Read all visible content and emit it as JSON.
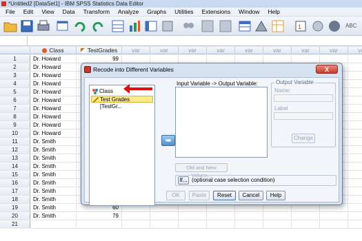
{
  "window": {
    "title": "*Untitled2 [DataSet1] - IBM SPSS Statistics Data Editor"
  },
  "menu": [
    "File",
    "Edit",
    "View",
    "Data",
    "Transform",
    "Analyze",
    "Graphs",
    "Utilities",
    "Extensions",
    "Window",
    "Help"
  ],
  "toolbar": {
    "icons": [
      "open-folder-icon",
      "save-icon",
      "print-icon",
      "dialog-recall-icon",
      "undo-icon",
      "redo-icon",
      "goto-case-icon",
      "goto-variable-icon",
      "variables-icon",
      "run-descriptives-icon",
      "find-icon",
      "insert-cases-icon",
      "insert-variable-icon",
      "split-file-icon",
      "weight-cases-icon",
      "select-cases-icon",
      "value-labels-icon",
      "use-variable-sets-icon",
      "show-all-variables-icon",
      "spell-check-icon"
    ],
    "abc_label": "ABC"
  },
  "grid": {
    "columns": [
      "Class",
      "TestGrades",
      "var",
      "var",
      "var",
      "var",
      "var",
      "var",
      "var",
      "var",
      "var"
    ],
    "rows": [
      {
        "n": "1",
        "class": "Dr. Howard",
        "grade": "99"
      },
      {
        "n": "2",
        "class": "Dr. Howard",
        "grade": ""
      },
      {
        "n": "3",
        "class": "Dr. Howard",
        "grade": ""
      },
      {
        "n": "4",
        "class": "Dr. Howard",
        "grade": ""
      },
      {
        "n": "5",
        "class": "Dr. Howard",
        "grade": ""
      },
      {
        "n": "6",
        "class": "Dr. Howard",
        "grade": ""
      },
      {
        "n": "7",
        "class": "Dr. Howard",
        "grade": ""
      },
      {
        "n": "8",
        "class": "Dr. Howard",
        "grade": ""
      },
      {
        "n": "9",
        "class": "Dr. Howard",
        "grade": ""
      },
      {
        "n": "10",
        "class": "Dr. Howard",
        "grade": ""
      },
      {
        "n": "11",
        "class": "Dr. Smith",
        "grade": ""
      },
      {
        "n": "12",
        "class": "Dr. Smith",
        "grade": ""
      },
      {
        "n": "13",
        "class": "Dr. Smith",
        "grade": ""
      },
      {
        "n": "14",
        "class": "Dr. Smith",
        "grade": ""
      },
      {
        "n": "15",
        "class": "Dr. Smith",
        "grade": ""
      },
      {
        "n": "16",
        "class": "Dr. Smith",
        "grade": ""
      },
      {
        "n": "17",
        "class": "Dr. Smith",
        "grade": ""
      },
      {
        "n": "18",
        "class": "Dr. Smith",
        "grade": "60"
      },
      {
        "n": "19",
        "class": "Dr. Smith",
        "grade": "60"
      },
      {
        "n": "20",
        "class": "Dr. Smith",
        "grade": "79"
      },
      {
        "n": "21",
        "class": "",
        "grade": ""
      }
    ]
  },
  "dialog": {
    "title": "Recode into Different Variables",
    "close_label": "X",
    "source_items": [
      {
        "label": "Class",
        "icon": "nominal-variable-icon"
      },
      {
        "label": "Test Grades [TestGr...",
        "icon": "scale-variable-icon"
      }
    ],
    "io_label": "Input Variable -> Output Variable:",
    "output_group": {
      "legend": "Output Variable",
      "name_label": "Name:",
      "label_label": "Label",
      "change_label": "Change"
    },
    "old_new_label": "Old and New Values...",
    "if_label": "If...",
    "if_text": "(optional case selection condition)",
    "buttons": {
      "ok": "OK",
      "paste": "Paste",
      "reset": "Reset",
      "cancel": "Cancel",
      "help": "Help"
    },
    "annotation_color": "#e01010"
  }
}
